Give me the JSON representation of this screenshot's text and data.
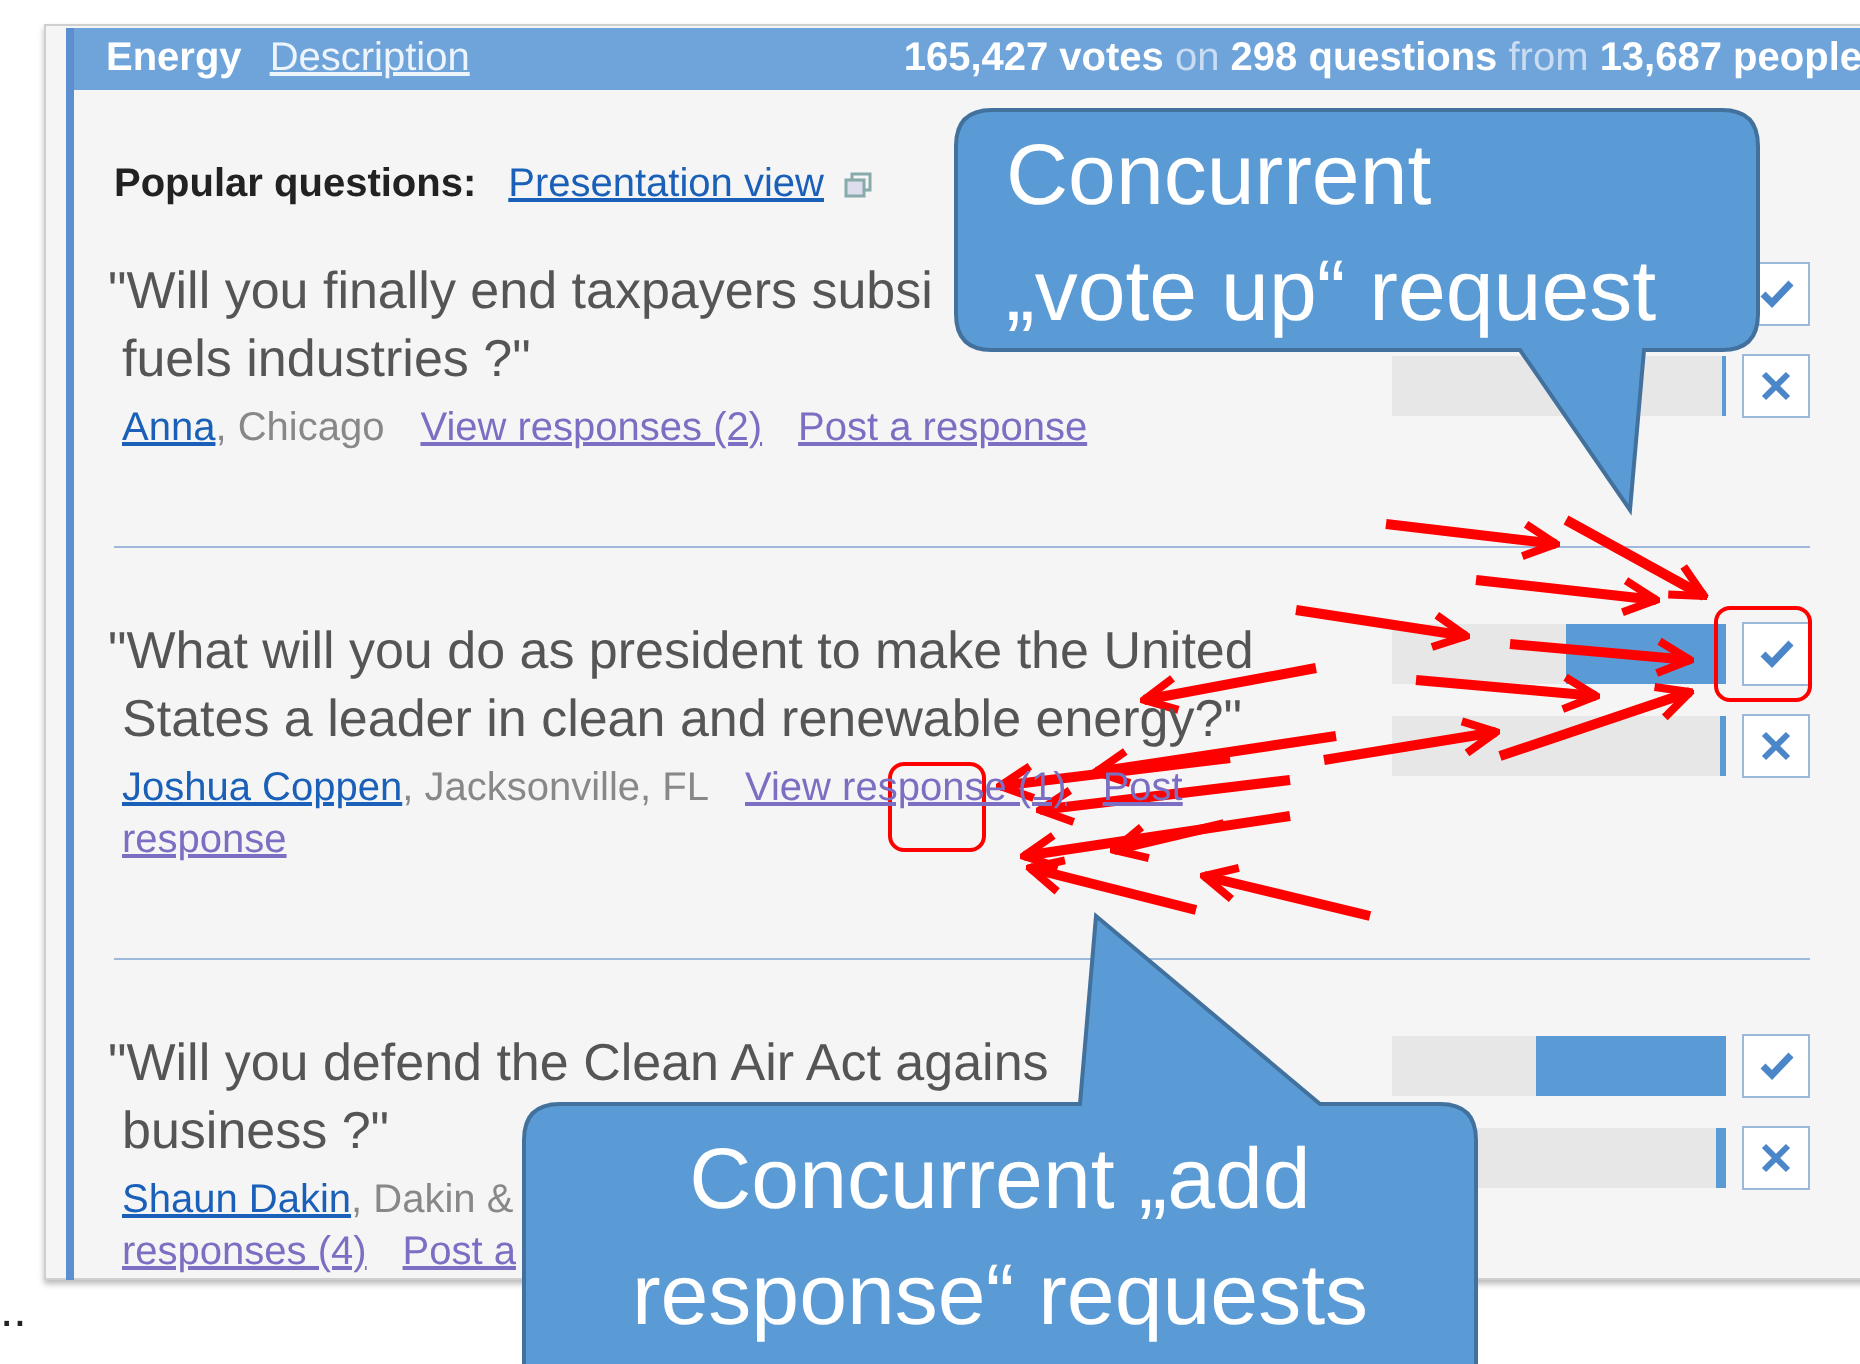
{
  "header": {
    "title": "Energy",
    "link": "Description",
    "stats": "**165,427 votes** on **298 questions** from **13,687 people**"
  },
  "popular": {
    "label": "Popular questions:",
    "link": "Presentation view"
  },
  "questions": [
    {
      "lines": [
        "\"Will you finally end taxpayers subsi",
        "fuels industries ?\""
      ],
      "meta": [
        [
          {
            "kind": "author",
            "text": "Anna"
          },
          {
            "kind": "place",
            "text": ", Chicago"
          },
          {
            "kind": "link",
            "text": "View responses (2)"
          },
          {
            "kind": "link",
            "text": "Post a response"
          }
        ]
      ],
      "down": {
        "level": 0.01
      }
    },
    {
      "lines": [
        "\"What will you do as president to make the United",
        "States a leader in clean and renewable energy?\""
      ],
      "meta": [
        [
          {
            "kind": "author",
            "text": "Joshua Coppen"
          },
          {
            "kind": "place",
            "text": ", Jacksonville, FL"
          },
          {
            "kind": "link",
            "text": "View response (1)"
          },
          {
            "kind": "link",
            "text": "Post"
          }
        ],
        [
          {
            "kind": "link",
            "text": "response"
          }
        ]
      ],
      "up": {
        "level": 0.48
      },
      "down": {
        "level": 0.02
      }
    },
    {
      "lines": [
        "\"Will you defend the Clean Air Act agains",
        "business ?\""
      ],
      "meta": [
        [
          {
            "kind": "author",
            "text": "Shaun Dakin"
          },
          {
            "kind": "place",
            "text": ", Dakin &"
          }
        ],
        [
          {
            "kind": "link",
            "text": "responses (4)"
          },
          {
            "kind": "link",
            "text": "Post a"
          }
        ]
      ],
      "up": {
        "level": 0.57
      },
      "down": {
        "level": 0.03
      }
    }
  ],
  "callouts": [
    {
      "lines": [
        "Concurrent",
        "„vote up“ request"
      ]
    },
    {
      "lines": [
        "Concurrent „add",
        "response“ requests"
      ]
    }
  ],
  "ellipsis": ".."
}
